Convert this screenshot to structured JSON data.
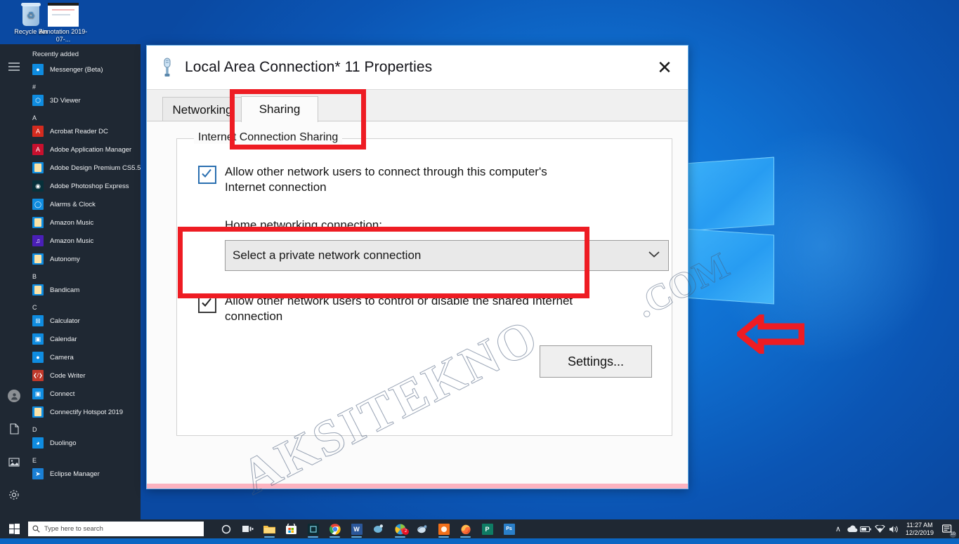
{
  "desktop": {
    "icons": [
      {
        "name": "recycle-bin",
        "label": "Recycle Bin"
      },
      {
        "name": "annotation-file",
        "label": "Annotation 2019-07-..."
      }
    ]
  },
  "start_menu": {
    "hamburger": "hamburger-icon",
    "rail": [
      {
        "name": "account",
        "icon": "user-icon"
      },
      {
        "name": "documents",
        "icon": "document-icon"
      },
      {
        "name": "pictures",
        "icon": "pictures-icon"
      },
      {
        "name": "settings",
        "icon": "gear-icon"
      },
      {
        "name": "power",
        "icon": "power-icon"
      }
    ],
    "recently_added_header": "Recently added",
    "groups": [
      {
        "letter": "#",
        "header_first": true,
        "items": [
          {
            "label": "Messenger (Beta)",
            "tile": "blue",
            "glyph": "●"
          }
        ]
      },
      {
        "letter": "#",
        "items": [
          {
            "label": "3D Viewer",
            "tile": "blue",
            "glyph": "⬡"
          }
        ]
      },
      {
        "letter": "A",
        "items": [
          {
            "label": "Acrobat Reader DC",
            "tile": "red",
            "glyph": "A"
          },
          {
            "label": "Adobe Application Manager",
            "tile": "crimson",
            "glyph": "A"
          },
          {
            "label": "Adobe Design Premium CS5.5",
            "tile": "folder",
            "glyph": ""
          },
          {
            "label": "Adobe Photoshop Express",
            "tile": "dark",
            "glyph": "◉"
          },
          {
            "label": "Alarms & Clock",
            "tile": "blue",
            "glyph": "⏱"
          },
          {
            "label": "Amazon Music",
            "tile": "folder",
            "glyph": ""
          },
          {
            "label": "Amazon Music",
            "tile": "purple",
            "glyph": "♫"
          },
          {
            "label": "Autonomy",
            "tile": "folder",
            "glyph": ""
          }
        ]
      },
      {
        "letter": "B",
        "items": [
          {
            "label": "Bandicam",
            "tile": "folder",
            "glyph": ""
          }
        ]
      },
      {
        "letter": "C",
        "items": [
          {
            "label": "Calculator",
            "tile": "blue",
            "glyph": "⌸"
          },
          {
            "label": "Calendar",
            "tile": "blue",
            "glyph": "Ὄ5"
          },
          {
            "label": "Camera",
            "tile": "blue",
            "glyph": "●"
          },
          {
            "label": "Code Writer",
            "tile": "dred",
            "glyph": "</>"
          },
          {
            "label": "Connect",
            "tile": "blue",
            "glyph": "▣"
          },
          {
            "label": "Connectify Hotspot 2019",
            "tile": "folder",
            "glyph": ""
          }
        ]
      },
      {
        "letter": "D",
        "items": [
          {
            "label": "Duolingo",
            "tile": "blue",
            "glyph": "◑"
          }
        ]
      },
      {
        "letter": "E",
        "items": [
          {
            "label": "Eclipse Manager",
            "tile": "wblue",
            "glyph": "➤"
          }
        ]
      }
    ]
  },
  "dialog": {
    "icon": "network-adapter-icon",
    "title": "Local Area Connection* 11 Properties",
    "close_label": "✕",
    "tabs": [
      {
        "name": "networking",
        "label": "Networking",
        "selected": false
      },
      {
        "name": "sharing",
        "label": "Sharing",
        "selected": true
      }
    ],
    "group_label": "Internet Connection Sharing",
    "checkbox_allow_connect": {
      "label": "Allow other network users to connect through this computer's Internet connection",
      "checked": true
    },
    "home_networking_label": "Home networking connection:",
    "home_networking_value": "Select a private network connection",
    "checkbox_allow_control": {
      "label": "Allow other network users to control or disable the shared Internet connection",
      "checked": true
    },
    "settings_button": "Settings...",
    "annotations": {
      "highlight_color": "#ee1c23",
      "arrow": "left-arrow-annotation"
    }
  },
  "watermark": {
    "line1": "AKSITEKNO",
    "line2": ".COM"
  },
  "taskbar": {
    "start_label": "start-icon",
    "search_placeholder": "Type here to search",
    "icons": [
      {
        "name": "cortana",
        "glyph": "◯",
        "color": "transparent",
        "running": false
      },
      {
        "name": "task-view",
        "glyph": "⌸",
        "color": "transparent",
        "running": false
      },
      {
        "name": "file-explorer",
        "glyph": "",
        "color": "#f0b429",
        "running": true
      },
      {
        "name": "microsoft-store",
        "glyph": "",
        "color": "#ffffff",
        "running": false
      },
      {
        "name": "dark-app",
        "glyph": "▣",
        "color": "#0c2b33",
        "running": true
      },
      {
        "name": "google-chrome",
        "glyph": "",
        "color": "#ffffff",
        "running": true
      },
      {
        "name": "microsoft-word",
        "glyph": "W",
        "color": "#2b579a",
        "running": true
      },
      {
        "name": "paint-3d",
        "glyph": "✿",
        "color": "transparent",
        "running": false
      },
      {
        "name": "colorful-app",
        "glyph": "",
        "color": "#2f9ad6",
        "running": true,
        "badge": "2"
      },
      {
        "name": "paint-swirl",
        "glyph": "◔",
        "color": "transparent",
        "running": false
      },
      {
        "name": "orange-app",
        "glyph": "●",
        "color": "#f2701a",
        "running": true
      },
      {
        "name": "mozilla-firefox",
        "glyph": "",
        "color": "transparent",
        "running": true
      },
      {
        "name": "microsoft-publisher",
        "glyph": "P",
        "color": "#0f7c64",
        "running": false
      },
      {
        "name": "adobe-photoshop",
        "glyph": "Ps",
        "color": "#2a7fc9",
        "running": false
      }
    ],
    "tray": [
      {
        "name": "show-hidden-icons",
        "glyph": "∧"
      },
      {
        "name": "onedrive-cloud",
        "glyph": "☁"
      },
      {
        "name": "battery",
        "glyph": "▭"
      },
      {
        "name": "wifi",
        "glyph": "◠"
      },
      {
        "name": "volume",
        "glyph": "ὐ9"
      }
    ],
    "time": "11:27 AM",
    "date": "12/2/2019",
    "action_center": "notifications-icon",
    "action_center_badge": "10"
  }
}
